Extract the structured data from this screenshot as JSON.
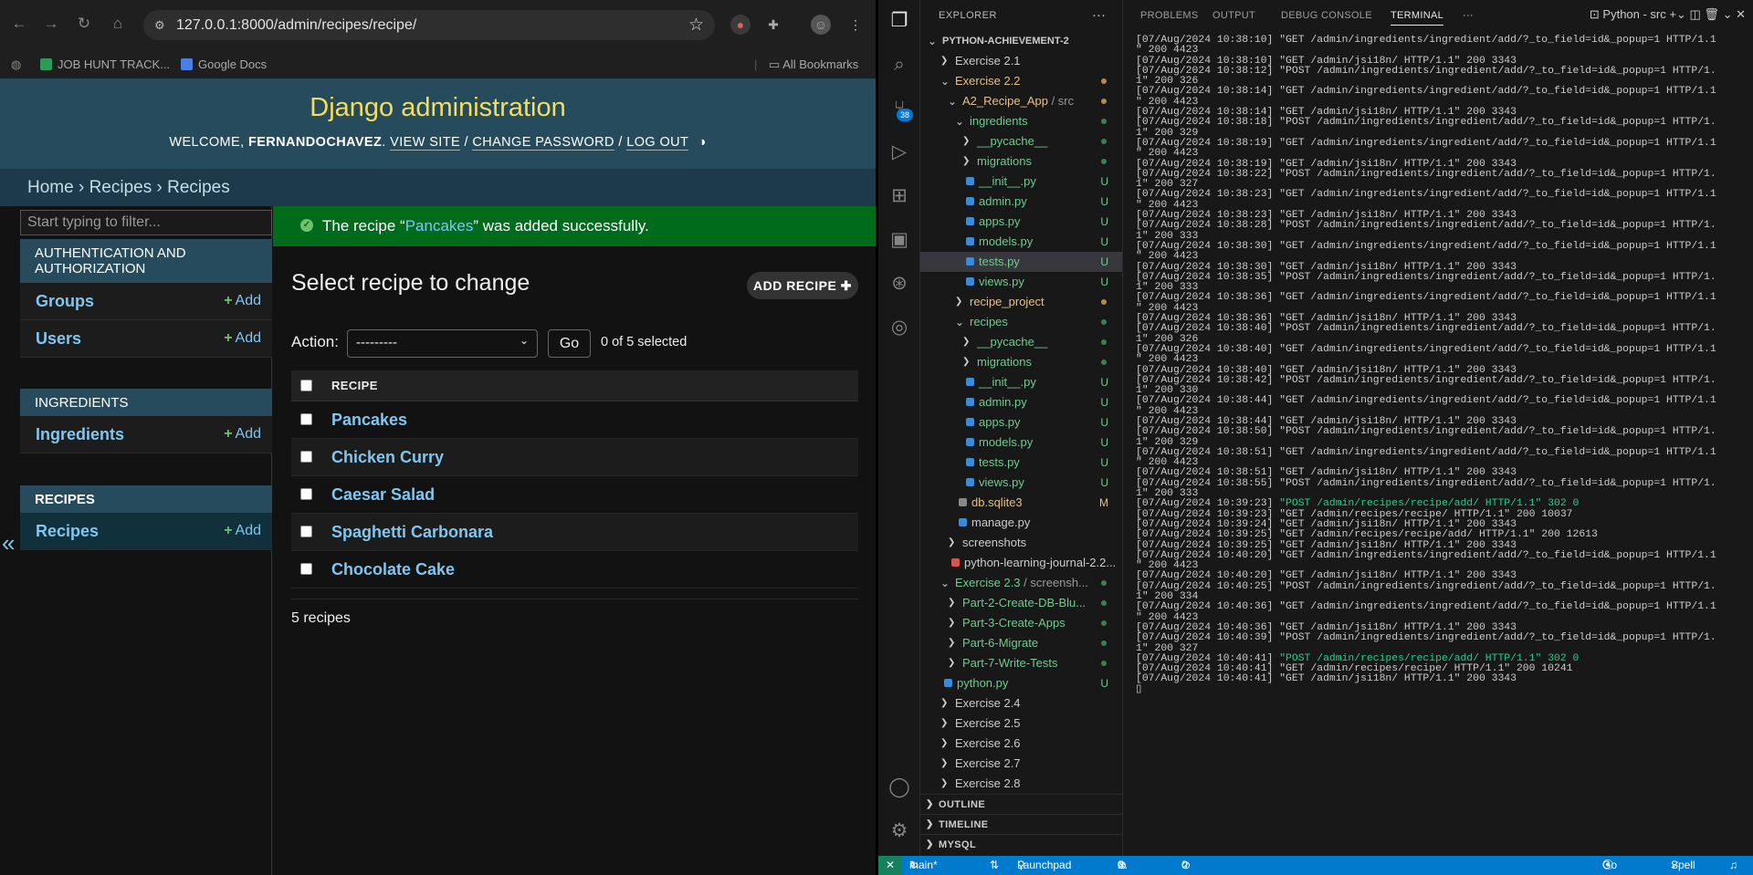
{
  "browser": {
    "url": "127.0.0.1:8000/admin/recipes/recipe/",
    "bookmarks": [
      "JOB HUNT TRACK...",
      "Google Docs"
    ],
    "all_bookmarks": "All Bookmarks"
  },
  "admin": {
    "brand": "Django administration",
    "welcome": "WELCOME,",
    "username": "FERNANDOCHAVEZ",
    "view_site": "VIEW SITE",
    "change_password": "CHANGE PASSWORD",
    "log_out": "LOG OUT",
    "breadcrumb": "Home › Recipes › Recipes",
    "filter_placeholder": "Start typing to filter...",
    "modules": [
      {
        "caption": "AUTHENTICATION AND AUTHORIZATION",
        "items": [
          "Groups",
          "Users"
        ]
      },
      {
        "caption": "INGREDIENTS",
        "items": [
          "Ingredients"
        ]
      },
      {
        "caption": "RECIPES",
        "items": [
          "Recipes"
        ]
      }
    ],
    "add_label": "Add",
    "message_pre": "The recipe “",
    "message_link": "Pancakes",
    "message_post": "” was added successfully.",
    "title": "Select recipe to change",
    "add_button": "ADD RECIPE",
    "action_label": "Action:",
    "action_value": "---------",
    "go": "Go",
    "selected": "0 of 5 selected",
    "column": "RECIPE",
    "rows": [
      "Pancakes",
      "Chicken Curry",
      "Caesar Salad",
      "Spaghetti Carbonara",
      "Chocolate Cake"
    ],
    "count": "5 recipes"
  },
  "vscode": {
    "explorer_title": "EXPLORER",
    "activity_badge": "38",
    "tree": [
      {
        "label": "PYTHON-ACHIEVEMENT-2",
        "indent": 0,
        "kind": "root",
        "bold": true
      },
      {
        "label": "Exercise 2.1",
        "indent": 1,
        "kind": "closed"
      },
      {
        "label": "Exercise 2.2",
        "indent": 1,
        "kind": "open",
        "color": "#e2c08d",
        "dot": "#b38a5a"
      },
      {
        "label": "A2_Recipe_App",
        "suffix": " / src",
        "indent": 2,
        "kind": "open",
        "color": "#e2c08d",
        "dot": "#b38a5a"
      },
      {
        "label": "ingredients",
        "indent": 3,
        "kind": "open",
        "color": "#73c991",
        "dot": "#3f7e4f"
      },
      {
        "label": "__pycache__",
        "indent": 4,
        "kind": "closed",
        "color": "#73c991",
        "dot": "#3f7e4f"
      },
      {
        "label": "migrations",
        "indent": 4,
        "kind": "closed",
        "color": "#73c991",
        "dot": "#3f7e4f"
      },
      {
        "label": "__init__.py",
        "indent": 4,
        "kind": "py",
        "color": "#73c991",
        "dec": "U"
      },
      {
        "label": "admin.py",
        "indent": 4,
        "kind": "py",
        "color": "#73c991",
        "dec": "U"
      },
      {
        "label": "apps.py",
        "indent": 4,
        "kind": "py",
        "color": "#73c991",
        "dec": "U"
      },
      {
        "label": "models.py",
        "indent": 4,
        "kind": "py",
        "color": "#73c991",
        "dec": "U"
      },
      {
        "label": "tests.py",
        "indent": 4,
        "kind": "py",
        "color": "#73c991",
        "dec": "U",
        "selected": true
      },
      {
        "label": "views.py",
        "indent": 4,
        "kind": "py",
        "color": "#73c991",
        "dec": "U"
      },
      {
        "label": "recipe_project",
        "indent": 3,
        "kind": "closed",
        "color": "#e2c08d",
        "dot": "#b38a5a"
      },
      {
        "label": "recipes",
        "indent": 3,
        "kind": "open",
        "color": "#73c991",
        "dot": "#3f7e4f"
      },
      {
        "label": "__pycache__",
        "indent": 4,
        "kind": "closed",
        "color": "#73c991",
        "dot": "#3f7e4f"
      },
      {
        "label": "migrations",
        "indent": 4,
        "kind": "closed",
        "color": "#73c991",
        "dot": "#3f7e4f"
      },
      {
        "label": "__init__.py",
        "indent": 4,
        "kind": "py",
        "color": "#73c991",
        "dec": "U"
      },
      {
        "label": "admin.py",
        "indent": 4,
        "kind": "py",
        "color": "#73c991",
        "dec": "U"
      },
      {
        "label": "apps.py",
        "indent": 4,
        "kind": "py",
        "color": "#73c991",
        "dec": "U"
      },
      {
        "label": "models.py",
        "indent": 4,
        "kind": "py",
        "color": "#73c991",
        "dec": "U"
      },
      {
        "label": "tests.py",
        "indent": 4,
        "kind": "py",
        "color": "#73c991",
        "dec": "U"
      },
      {
        "label": "views.py",
        "indent": 4,
        "kind": "py",
        "color": "#73c991",
        "dec": "U"
      },
      {
        "label": "db.sqlite3",
        "indent": 3,
        "kind": "db",
        "color": "#e2c08d",
        "dec": "M"
      },
      {
        "label": "manage.py",
        "indent": 3,
        "kind": "py",
        "color": "#cccccc"
      },
      {
        "label": "screenshots",
        "indent": 2,
        "kind": "closed",
        "color": "#cccccc"
      },
      {
        "label": "python-learning-journal-2.2...",
        "indent": 2,
        "kind": "pdf",
        "color": "#cccccc"
      },
      {
        "label": "Exercise 2.3",
        "suffix": " / screensh...",
        "indent": 1,
        "kind": "open",
        "color": "#73c991",
        "dot": "#3f7e4f"
      },
      {
        "label": "Part-2-Create-DB-Blu...",
        "indent": 2,
        "kind": "closed",
        "color": "#73c991",
        "dot": "#3f7e4f"
      },
      {
        "label": "Part-3-Create-Apps",
        "indent": 2,
        "kind": "closed",
        "color": "#73c991",
        "dot": "#3f7e4f"
      },
      {
        "label": "Part-6-Migrate",
        "indent": 2,
        "kind": "closed",
        "color": "#73c991",
        "dot": "#3f7e4f"
      },
      {
        "label": "Part-7-Write-Tests",
        "indent": 2,
        "kind": "closed",
        "color": "#73c991",
        "dot": "#3f7e4f"
      },
      {
        "label": "python.py",
        "indent": 1,
        "kind": "py",
        "color": "#73c991",
        "dec": "U"
      },
      {
        "label": "Exercise 2.4",
        "indent": 1,
        "kind": "closed"
      },
      {
        "label": "Exercise 2.5",
        "indent": 1,
        "kind": "closed"
      },
      {
        "label": "Exercise 2.6",
        "indent": 1,
        "kind": "closed"
      },
      {
        "label": "Exercise 2.7",
        "indent": 1,
        "kind": "closed"
      },
      {
        "label": "Exercise 2.8",
        "indent": 1,
        "kind": "closed"
      }
    ],
    "sections": [
      "OUTLINE",
      "TIMELINE",
      "MYSQL"
    ],
    "panel_tabs": [
      "PROBLEMS",
      "OUTPUT",
      "DEBUG CONSOLE",
      "TERMINAL"
    ],
    "terminal_name": "Python - src",
    "terminal_lines": [
      "[07/Aug/2024 10:38:10] \"GET /admin/ingredients/ingredient/add/?_to_field=id&_popup=1 HTTP/1.1",
      "\" 200 4423",
      "[07/Aug/2024 10:38:10] \"GET /admin/jsi18n/ HTTP/1.1\" 200 3343",
      "[07/Aug/2024 10:38:12] \"POST /admin/ingredients/ingredient/add/?_to_field=id&_popup=1 HTTP/1.",
      "1\" 200 326",
      "[07/Aug/2024 10:38:14] \"GET /admin/ingredients/ingredient/add/?_to_field=id&_popup=1 HTTP/1.1",
      "\" 200 4423",
      "[07/Aug/2024 10:38:14] \"GET /admin/jsi18n/ HTTP/1.1\" 200 3343",
      "[07/Aug/2024 10:38:18] \"POST /admin/ingredients/ingredient/add/?_to_field=id&_popup=1 HTTP/1.",
      "1\" 200 329",
      "[07/Aug/2024 10:38:19] \"GET /admin/ingredients/ingredient/add/?_to_field=id&_popup=1 HTTP/1.1",
      "\" 200 4423",
      "[07/Aug/2024 10:38:19] \"GET /admin/jsi18n/ HTTP/1.1\" 200 3343",
      "[07/Aug/2024 10:38:22] \"POST /admin/ingredients/ingredient/add/?_to_field=id&_popup=1 HTTP/1.",
      "1\" 200 327",
      "[07/Aug/2024 10:38:23] \"GET /admin/ingredients/ingredient/add/?_to_field=id&_popup=1 HTTP/1.1",
      "\" 200 4423",
      "[07/Aug/2024 10:38:23] \"GET /admin/jsi18n/ HTTP/1.1\" 200 3343",
      "[07/Aug/2024 10:38:28] \"POST /admin/ingredients/ingredient/add/?_to_field=id&_popup=1 HTTP/1.",
      "1\" 200 333",
      "[07/Aug/2024 10:38:30] \"GET /admin/ingredients/ingredient/add/?_to_field=id&_popup=1 HTTP/1.1",
      "\" 200 4423",
      "[07/Aug/2024 10:38:30] \"GET /admin/jsi18n/ HTTP/1.1\" 200 3343",
      "[07/Aug/2024 10:38:35] \"POST /admin/ingredients/ingredient/add/?_to_field=id&_popup=1 HTTP/1.",
      "1\" 200 333",
      "[07/Aug/2024 10:38:36] \"GET /admin/ingredients/ingredient/add/?_to_field=id&_popup=1 HTTP/1.1",
      "\" 200 4423",
      "[07/Aug/2024 10:38:36] \"GET /admin/jsi18n/ HTTP/1.1\" 200 3343",
      "[07/Aug/2024 10:38:40] \"POST /admin/ingredients/ingredient/add/?_to_field=id&_popup=1 HTTP/1.",
      "1\" 200 326",
      "[07/Aug/2024 10:38:40] \"GET /admin/ingredients/ingredient/add/?_to_field=id&_popup=1 HTTP/1.1",
      "\" 200 4423",
      "[07/Aug/2024 10:38:40] \"GET /admin/jsi18n/ HTTP/1.1\" 200 3343",
      "[07/Aug/2024 10:38:42] \"POST /admin/ingredients/ingredient/add/?_to_field=id&_popup=1 HTTP/1.",
      "1\" 200 330",
      "[07/Aug/2024 10:38:44] \"GET /admin/ingredients/ingredient/add/?_to_field=id&_popup=1 HTTP/1.1",
      "\" 200 4423",
      "[07/Aug/2024 10:38:44] \"GET /admin/jsi18n/ HTTP/1.1\" 200 3343",
      "[07/Aug/2024 10:38:50] \"POST /admin/ingredients/ingredient/add/?_to_field=id&_popup=1 HTTP/1.",
      "1\" 200 329",
      "[07/Aug/2024 10:38:51] \"GET /admin/ingredients/ingredient/add/?_to_field=id&_popup=1 HTTP/1.1",
      "\" 200 4423",
      "[07/Aug/2024 10:38:51] \"GET /admin/jsi18n/ HTTP/1.1\" 200 3343",
      "[07/Aug/2024 10:38:55] \"POST /admin/ingredients/ingredient/add/?_to_field=id&_popup=1 HTTP/1.",
      "1\" 200 333",
      "[07/Aug/2024 10:39:23] \"POST /admin/recipes/recipe/add/ HTTP/1.1\" 302 0",
      "[07/Aug/2024 10:39:23] \"GET /admin/recipes/recipe/ HTTP/1.1\" 200 10037",
      "[07/Aug/2024 10:39:24] \"GET /admin/jsi18n/ HTTP/1.1\" 200 3343",
      "[07/Aug/2024 10:39:25] \"GET /admin/recipes/recipe/add/ HTTP/1.1\" 200 12613",
      "[07/Aug/2024 10:39:25] \"GET /admin/jsi18n/ HTTP/1.1\" 200 3343",
      "[07/Aug/2024 10:40:20] \"GET /admin/ingredients/ingredient/add/?_to_field=id&_popup=1 HTTP/1.1",
      "\" 200 4423",
      "[07/Aug/2024 10:40:20] \"GET /admin/jsi18n/ HTTP/1.1\" 200 3343",
      "[07/Aug/2024 10:40:25] \"POST /admin/ingredients/ingredient/add/?_to_field=id&_popup=1 HTTP/1.",
      "1\" 200 334",
      "[07/Aug/2024 10:40:36] \"GET /admin/ingredients/ingredient/add/?_to_field=id&_popup=1 HTTP/1.1",
      "\" 200 4423",
      "[07/Aug/2024 10:40:36] \"GET /admin/jsi18n/ HTTP/1.1\" 200 3343",
      "[07/Aug/2024 10:40:39] \"POST /admin/ingredients/ingredient/add/?_to_field=id&_popup=1 HTTP/1.",
      "1\" 200 327",
      "[07/Aug/2024 10:40:41] \"POST /admin/recipes/recipe/add/ HTTP/1.1\" 302 0",
      "[07/Aug/2024 10:40:41] \"GET /admin/recipes/recipe/ HTTP/1.1\" 200 10241",
      "[07/Aug/2024 10:40:41] \"GET /admin/jsi18n/ HTTP/1.1\" 200 3343"
    ],
    "highlight_color": "#23d18b",
    "status": {
      "branch": "main*",
      "launchpad": "Launchpad",
      "errors": "0",
      "warnings": "0",
      "ports": "0",
      "go_live": "Go Live",
      "spell": "Spell"
    },
    "colors": {
      "statusbar": "#007acc",
      "accent_header": "#264b5d",
      "brand_yellow": "#f5dd5d",
      "success": "#006b1b"
    }
  }
}
